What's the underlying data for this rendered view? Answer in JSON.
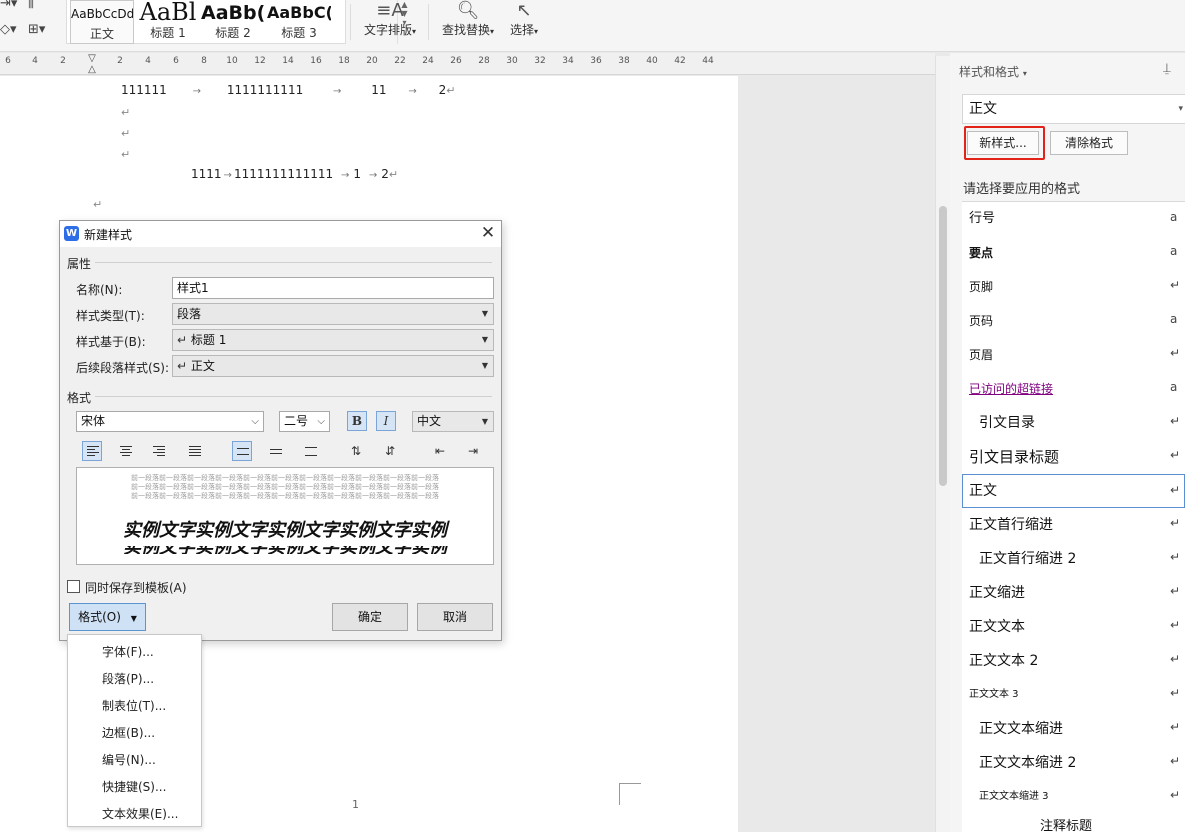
{
  "ribbon": {
    "styles": [
      {
        "sample": "AaBbCcDd",
        "label": "正文"
      },
      {
        "sample": "AaBl",
        "label": "标题 1"
      },
      {
        "sample": "AaBb(",
        "label": "标题 2"
      },
      {
        "sample": "AaBbC(",
        "label": "标题 3"
      }
    ],
    "text_layout": "文字排版",
    "find_replace": "查找替换",
    "select": "选择"
  },
  "ruler": {
    "ticks": [
      "6",
      "4",
      "2",
      "2",
      "4",
      "6",
      "8",
      "10",
      "12",
      "14",
      "16",
      "18",
      "20",
      "22",
      "24",
      "26",
      "28",
      "30",
      "32",
      "34",
      "36",
      "38",
      "40",
      "42",
      "44"
    ]
  },
  "document": {
    "line1": {
      "a": "111111",
      "b": "1111111111",
      "c": "11",
      "d": "2"
    },
    "line2": {
      "a": "1111",
      "b": "1111111111111",
      "c": "1",
      "d": "2"
    },
    "page_number": "1"
  },
  "dialog": {
    "title": "新建样式",
    "section_properties": "属性",
    "name_label": "名称(N):",
    "name_value": "样式1",
    "type_label": "样式类型(T):",
    "type_value": "段落",
    "based_label": "样式基于(B):",
    "based_value": "标题 1",
    "next_label": "后续段落样式(S):",
    "next_value": "正文",
    "section_format": "格式",
    "font_value": "宋体",
    "size_value": "二号",
    "bold_label": "B",
    "italic_label": "I",
    "lang_value": "中文",
    "preview_prev_text": "前一段落前一段落前一段落前一段落前一段落前一段落前一段落前一段落前一段落前一段落前一段落",
    "preview_sample": "实例文字实例文字实例文字实例文字实例",
    "save_template_label": "同时保存到模板(A)",
    "format_button": "格式(O)",
    "ok_button": "确定",
    "cancel_button": "取消"
  },
  "format_menu": {
    "items": [
      "字体(F)...",
      "段落(P)...",
      "制表位(T)...",
      "边框(B)...",
      "编号(N)...",
      "快捷键(S)...",
      "文本效果(E)..."
    ]
  },
  "styles_pane": {
    "title": "样式和格式",
    "current_style": "正文",
    "new_style_button": "新样式...",
    "clear_format_button": "清除格式",
    "hint": "请选择要应用的格式",
    "highlight_color": "#e2231a",
    "items": [
      {
        "name": "行号",
        "mark": "a"
      },
      {
        "name": "要点",
        "mark": "a"
      },
      {
        "name": "页脚",
        "mark": "↵"
      },
      {
        "name": "页码",
        "mark": "a"
      },
      {
        "name": "页眉",
        "mark": "↵"
      },
      {
        "name": "已访问的超链接",
        "mark": "a"
      },
      {
        "name": "引文目录",
        "mark": "↵"
      },
      {
        "name": "引文目录标题",
        "mark": "↵"
      },
      {
        "name": "正文",
        "mark": "↵"
      },
      {
        "name": "正文首行缩进",
        "mark": "↵"
      },
      {
        "name": "正文首行缩进 2",
        "mark": "↵"
      },
      {
        "name": "正文缩进",
        "mark": "↵"
      },
      {
        "name": "正文文本",
        "mark": "↵"
      },
      {
        "name": "正文文本 2",
        "mark": "↵"
      },
      {
        "name": "正文文本 3",
        "mark": "↵"
      },
      {
        "name": "正文文本缩进",
        "mark": "↵"
      },
      {
        "name": "正文文本缩进 2",
        "mark": "↵"
      },
      {
        "name": "正文文本缩进 3",
        "mark": "↵"
      },
      {
        "name": "注释标题",
        "mark": ""
      }
    ]
  }
}
